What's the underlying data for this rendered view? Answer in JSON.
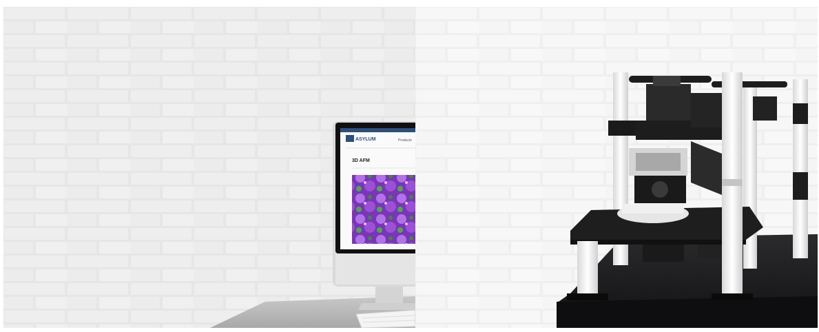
{
  "scene": {
    "left_panel": {
      "monitor": {
        "logo_text": "ASYLUM",
        "nav_text": "Products",
        "page_heading": "3D AFM"
      }
    },
    "right_panel": {}
  },
  "colors": {
    "wall": "#e9e9e9",
    "mortar": "#dcdcdc",
    "desk": "#bdbdbd",
    "table_top": "#1c1c1e",
    "frame_white": "#f1f1f1",
    "instrument_black": "#222222",
    "screen_purple": "#8a3fc4",
    "screen_green": "#3e8a3a"
  }
}
